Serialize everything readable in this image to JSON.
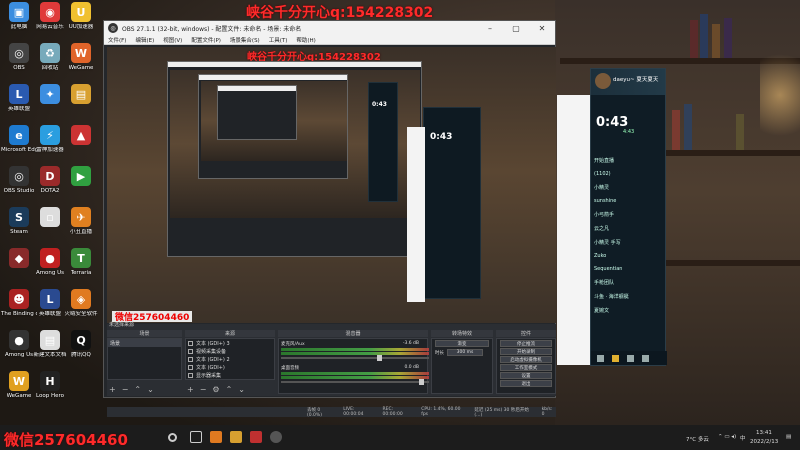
{
  "overlay": {
    "top_text": "峡谷千分开心q:154228302",
    "inner_text": "峡谷千分开心q:154228302",
    "bottom_text": "微信257604460",
    "preview_tag": "微信257604460"
  },
  "desktop_icons": [
    {
      "label": "此电脑",
      "color": "#3c8ee0",
      "glyph": "▣"
    },
    {
      "label": "网易云音乐",
      "color": "#e03a3a",
      "glyph": "◉"
    },
    {
      "label": "UU加速器",
      "color": "#f0c030",
      "glyph": "U"
    },
    {
      "label": "OBS",
      "color": "#444",
      "glyph": "◎"
    },
    {
      "label": "回收站",
      "color": "#7ab",
      "glyph": "♻"
    },
    {
      "label": "WeGame",
      "color": "#e0642a",
      "glyph": "W"
    },
    {
      "label": "英雄联盟",
      "color": "#2a5ab0",
      "glyph": "L"
    },
    {
      "label": "",
      "color": "#3c8ee0",
      "glyph": "✦"
    },
    {
      "label": "",
      "color": "#d8a030",
      "glyph": "▤"
    },
    {
      "label": "Microsoft Edge",
      "color": "#1e7bd0",
      "glyph": "e"
    },
    {
      "label": "雷神加速器",
      "color": "#2a9ee0",
      "glyph": "⚡"
    },
    {
      "label": "",
      "color": "#cc3333",
      "glyph": "▲"
    },
    {
      "label": "OBS Studio",
      "color": "#333",
      "glyph": "◎"
    },
    {
      "label": "DOTA2",
      "color": "#9a2a2a",
      "glyph": "D"
    },
    {
      "label": "",
      "color": "#30a040",
      "glyph": "▶"
    },
    {
      "label": "Steam",
      "color": "#1b3b5a",
      "glyph": "S"
    },
    {
      "label": "",
      "color": "#ddd",
      "glyph": "▫"
    },
    {
      "label": "小丑直播",
      "color": "#e08020",
      "glyph": "✈"
    },
    {
      "label": "",
      "color": "#882a2a",
      "glyph": "◆"
    },
    {
      "label": "Among Us",
      "color": "#c02020",
      "glyph": "●"
    },
    {
      "label": "Terraria",
      "color": "#3a8a3a",
      "glyph": "T"
    },
    {
      "label": "The Binding of Isaac",
      "color": "#aa2222",
      "glyph": "☻"
    },
    {
      "label": "英雄联盟",
      "color": "#2a4a90",
      "glyph": "L"
    },
    {
      "label": "火绒安全软件",
      "color": "#e07a20",
      "glyph": "◈"
    },
    {
      "label": "Among Us",
      "color": "#333",
      "glyph": "●"
    },
    {
      "label": "新建文本文档",
      "color": "#ddd",
      "glyph": "▤"
    },
    {
      "label": "腾讯QQ",
      "color": "#111",
      "glyph": "Q"
    },
    {
      "label": "WeGame",
      "color": "#e0a020",
      "glyph": "W"
    },
    {
      "label": "Loop Hero",
      "color": "#222",
      "glyph": "H"
    }
  ],
  "obs": {
    "title": "OBS 27.1.1 (32-bit, windows) - 配置文件: 未命名 - 场景: 未命名",
    "menu": [
      "文件(F)",
      "编辑(E)",
      "视图(V)",
      "配置文件(P)",
      "场景集合(S)",
      "工具(T)",
      "帮助(H)"
    ],
    "no_source": "未选择来源",
    "docks": {
      "scenes": "场景",
      "sources": "来源",
      "mixer": "混音器",
      "transitions": "转场特效",
      "controls": "控件"
    },
    "scene_item": "场景",
    "sources_list": [
      "文本 (GDI+) 3",
      "视频采集设备",
      "文本 (GDI+) 2",
      "文本 (GDI+)",
      "显示器采集"
    ],
    "mixer_channels": [
      {
        "name": "麦克风/Aux",
        "db": "-3.6 dB"
      },
      {
        "name": "桌面音频",
        "db": "0.0 dB"
      }
    ],
    "transition": {
      "type": "渐变",
      "duration_label": "时长",
      "duration": "300 ms"
    },
    "controls": [
      "停止推流",
      "开始录制",
      "启动虚拟摄像机",
      "工作室模式",
      "设置",
      "退出"
    ],
    "status": [
      "丢帧 0 (0.0%)",
      "LIVE: 00:00:04",
      "REC: 00:00:00",
      "CPU: 1.4%, 60.00 fps",
      "延迟 (25 ms) 30 秒后开始(...)",
      "kb/s: 0"
    ]
  },
  "qq_panel": {
    "name": "daeyu~ 夏天夏天",
    "time": "0:43",
    "sub": "4:43",
    "messages": [
      "开始直播",
      "(1102)",
      "小精灵",
      "sunshine",
      "小弓箭手",
      "云之凡",
      "小精灵 手写",
      "Zuko",
      "Sequentian",
      "手枪团队",
      "斗鱼 · 海洋舰艇",
      "夏婉文"
    ]
  },
  "taskbar": {
    "time": "13:41",
    "date": "2022/2/13",
    "weather": "7°C 多云",
    "ime": "中"
  }
}
